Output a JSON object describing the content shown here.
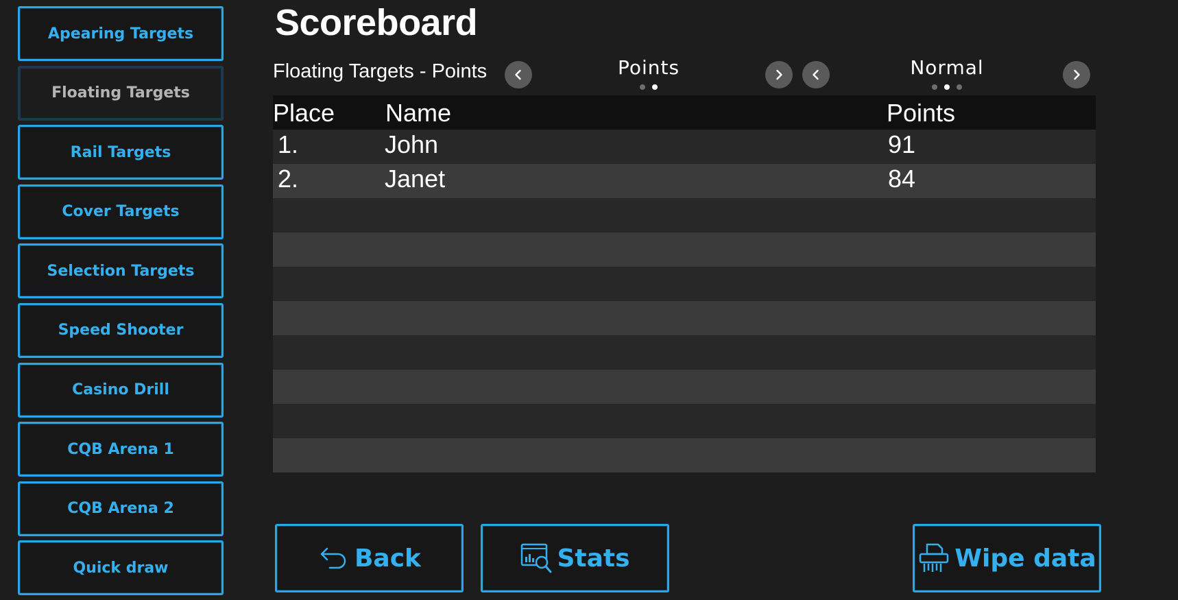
{
  "sidebar": {
    "items": [
      {
        "label": "Apearing Targets",
        "active": false
      },
      {
        "label": "Floating Targets",
        "active": true
      },
      {
        "label": "Rail Targets",
        "active": false
      },
      {
        "label": "Cover Targets",
        "active": false
      },
      {
        "label": "Selection Targets",
        "active": false
      },
      {
        "label": "Speed Shooter",
        "active": false
      },
      {
        "label": "Casino Drill",
        "active": false
      },
      {
        "label": "CQB Arena 1",
        "active": false
      },
      {
        "label": "CQB Arena 2",
        "active": false
      },
      {
        "label": "Quick draw",
        "active": false
      }
    ]
  },
  "header": {
    "title": "Scoreboard",
    "subtitle": "Floating Targets - Points"
  },
  "selectors": {
    "metric": {
      "label": "Points",
      "dot_count": 2,
      "active_dot": 2
    },
    "difficulty": {
      "label": "Normal",
      "dot_count": 3,
      "active_dot": 2
    }
  },
  "table": {
    "columns": [
      "Place",
      "Name",
      "Points"
    ],
    "rows": [
      {
        "place": "1.",
        "name": "John",
        "points": "91"
      },
      {
        "place": "2.",
        "name": "Janet",
        "points": "84"
      },
      {
        "place": "",
        "name": "",
        "points": ""
      },
      {
        "place": "",
        "name": "",
        "points": ""
      },
      {
        "place": "",
        "name": "",
        "points": ""
      },
      {
        "place": "",
        "name": "",
        "points": ""
      },
      {
        "place": "",
        "name": "",
        "points": ""
      },
      {
        "place": "",
        "name": "",
        "points": ""
      },
      {
        "place": "",
        "name": "",
        "points": ""
      },
      {
        "place": "",
        "name": "",
        "points": ""
      }
    ]
  },
  "actions": {
    "back_label": "Back",
    "stats_label": "Stats",
    "wipe_label": "Wipe data"
  },
  "icons": {
    "back": "undo-arrow-icon",
    "stats": "chart-magnifier-icon",
    "wipe": "shredder-icon",
    "prev": "chevron-left-icon",
    "next": "chevron-right-icon"
  },
  "colors": {
    "accent": "#27a6e8",
    "accent_text": "#35b0ef",
    "background": "#1d1d1d",
    "row_dark": "#282828",
    "row_light": "#3b3b3b"
  }
}
